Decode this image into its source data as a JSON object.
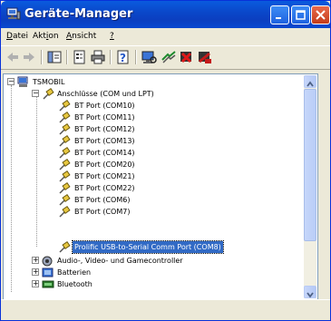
{
  "window": {
    "title": "Geräte-Manager"
  },
  "menu": [
    {
      "key": "D",
      "rest": "atei"
    },
    {
      "pre": "Akt",
      "key": "i",
      "rest": "on"
    },
    {
      "key": "A",
      "rest": "nsicht"
    },
    {
      "key": "?",
      "rest": ""
    }
  ],
  "toolbar": {
    "icons": [
      "back-arrow-icon",
      "forward-arrow-icon",
      "console-tree-icon",
      "properties-icon",
      "print-icon",
      "help-icon",
      "scan-hardware-icon",
      "update-driver-icon",
      "uninstall-icon",
      "disable-device-icon"
    ]
  },
  "tree": {
    "root": "TSMOBIL",
    "ports_group": "Anschlüsse (COM und LPT)",
    "ports": [
      "BT Port (COM10)",
      "BT Port (COM11)",
      "BT Port (COM12)",
      "BT Port (COM13)",
      "BT Port (COM14)",
      "BT Port (COM20)",
      "BT Port (COM21)",
      "BT Port (COM22)",
      "BT Port (COM6)",
      "BT Port (COM7)",
      "Prolific USB-to-Serial Comm Port (COM8)"
    ],
    "selected_index": 10,
    "groups": [
      "Audio-, Video- und Gamecontroller",
      "Batterien",
      "Bluetooth"
    ]
  }
}
